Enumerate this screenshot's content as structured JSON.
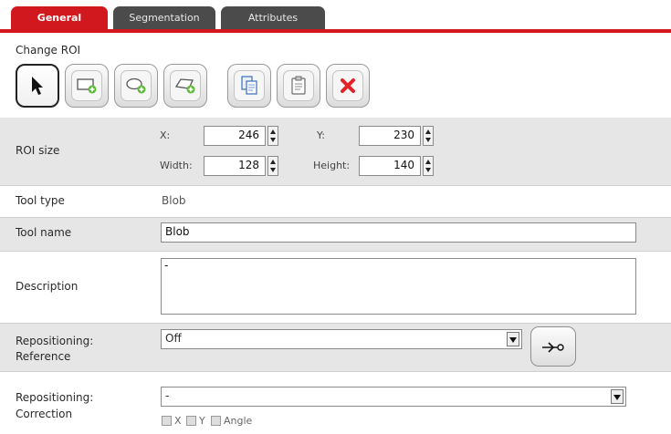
{
  "tabs": [
    {
      "label": "General"
    },
    {
      "label": "Segmentation"
    },
    {
      "label": "Attributes"
    }
  ],
  "change_roi": {
    "title": "Change ROI",
    "buttons": [
      {
        "icon": "pointer-arrow-icon"
      },
      {
        "icon": "add-rectangle-icon"
      },
      {
        "icon": "add-ellipse-icon"
      },
      {
        "icon": "add-polygon-icon"
      },
      {
        "icon": "copy-icon"
      },
      {
        "icon": "paste-icon"
      },
      {
        "icon": "delete-icon"
      }
    ]
  },
  "roi_size": {
    "label": "ROI size",
    "x_label": "X:",
    "x_value": "246",
    "y_label": "Y:",
    "y_value": "230",
    "width_label": "Width:",
    "width_value": "128",
    "height_label": "Height:",
    "height_value": "140"
  },
  "tool_type": {
    "label": "Tool type",
    "value": "Blob"
  },
  "tool_name": {
    "label": "Tool name",
    "value": "Blob"
  },
  "description": {
    "label": "Description",
    "value": "-"
  },
  "repositioning_reference": {
    "label_line1": "Repositioning:",
    "label_line2": "Reference",
    "selected": "Off",
    "button_icon": "link-arrow-icon"
  },
  "repositioning_correction": {
    "label_line1": "Repositioning:",
    "label_line2": "Correction",
    "selected": "-",
    "checks": [
      {
        "label": "X"
      },
      {
        "label": "Y"
      },
      {
        "label": "Angle"
      }
    ]
  },
  "colors": {
    "accent": "#d0181e",
    "tab_inactive": "#4b4b4b",
    "row_gray": "#e6e6e6",
    "delete_red": "#e0242a"
  }
}
